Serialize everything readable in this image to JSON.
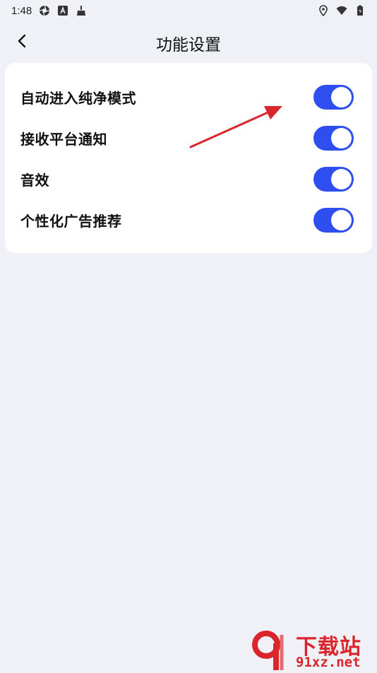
{
  "status_bar": {
    "time": "1:48",
    "left_icons": [
      "aperture-icon",
      "a-letter-icon",
      "broom-icon"
    ],
    "right_icons": [
      "location-icon",
      "wifi-icon",
      "battery-icon"
    ]
  },
  "header": {
    "title": "功能设置",
    "back_icon": "chevron-left-icon"
  },
  "settings": {
    "items": [
      {
        "label": "自动进入纯净模式",
        "enabled": true
      },
      {
        "label": "接收平台通知",
        "enabled": true
      },
      {
        "label": "音效",
        "enabled": true
      },
      {
        "label": "个性化广告推荐",
        "enabled": true
      }
    ]
  },
  "colors": {
    "background": "#f0f1f6",
    "card": "#ffffff",
    "toggle_on": "#2f4ef0",
    "annotation_arrow": "#d9252b"
  },
  "watermark": {
    "line1": "下载站",
    "line2": "91xz.net"
  }
}
